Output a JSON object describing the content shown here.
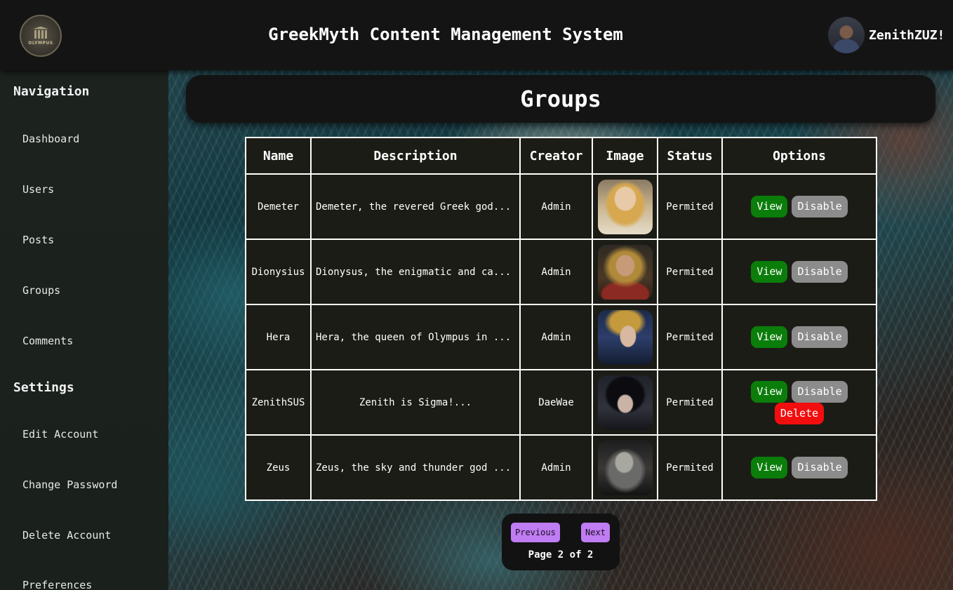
{
  "app": {
    "title": "GreekMyth Content Management System",
    "logo_text": "OLYMPUS",
    "user_name": "ZenithZUZ!"
  },
  "sidebar": {
    "navigation_title": "Navigation",
    "nav_items": [
      "Dashboard",
      "Users",
      "Posts",
      "Groups",
      "Comments"
    ],
    "settings_title": "Settings",
    "settings_items": [
      "Edit Account",
      "Change Password",
      "Delete Account",
      "Preferences"
    ]
  },
  "page": {
    "heading": "Groups"
  },
  "table": {
    "headers": [
      "Name",
      "Description",
      "Creator",
      "Image",
      "Status",
      "Options"
    ],
    "rows": [
      {
        "name": "Demeter",
        "description": "Demeter, the revered Greek god...",
        "creator": "Admin",
        "image": "demeter-portrait",
        "status": "Permited",
        "options": [
          "View",
          "Disable"
        ]
      },
      {
        "name": "Dionysius",
        "description": "Dionysus, the enigmatic and ca...",
        "creator": "Admin",
        "image": "dionysus-portrait",
        "status": "Permited",
        "options": [
          "View",
          "Disable"
        ]
      },
      {
        "name": "Hera",
        "description": "Hera, the queen of Olympus in ...",
        "creator": "Admin",
        "image": "hera-portrait",
        "status": "Permited",
        "options": [
          "View",
          "Disable"
        ]
      },
      {
        "name": "ZenithSUS",
        "description": "Zenith is Sigma!...",
        "creator": "DaeWae",
        "image": "anime-portrait",
        "status": "Permited",
        "options": [
          "View",
          "Disable",
          "Delete"
        ]
      },
      {
        "name": "Zeus",
        "description": "Zeus, the sky and thunder god ...",
        "creator": "Admin",
        "image": "zeus-portrait",
        "status": "Permited",
        "options": [
          "View",
          "Disable"
        ]
      }
    ]
  },
  "pagination": {
    "previous_label": "Previous",
    "next_label": "Next",
    "page_label": "Page 2 of 2"
  },
  "colors": {
    "header_bg": "#141414",
    "sidebar_bg": "#1c231f",
    "view_button": "#0a7d0a",
    "disable_button": "#8c8c8c",
    "delete_button": "#f20e0e",
    "pager_button": "#c07cf3"
  }
}
